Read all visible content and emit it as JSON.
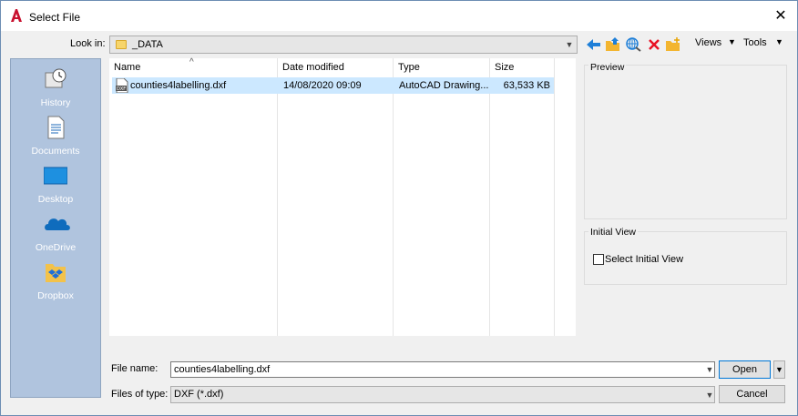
{
  "window": {
    "title": "Select File",
    "close_glyph": "✕"
  },
  "lookin": {
    "label": "Look in:",
    "value": "_DATA"
  },
  "toolbar": {
    "views_label": "Views",
    "tools_label": "Tools"
  },
  "places": [
    {
      "label": "History",
      "icon": "history-icon"
    },
    {
      "label": "Documents",
      "icon": "documents-icon"
    },
    {
      "label": "Desktop",
      "icon": "desktop-icon"
    },
    {
      "label": "OneDrive",
      "icon": "onedrive-icon"
    },
    {
      "label": "Dropbox",
      "icon": "dropbox-icon"
    }
  ],
  "filelist": {
    "columns": [
      "Name",
      "Date modified",
      "Type",
      "Size"
    ],
    "rows": [
      {
        "name": "counties4labelling.dxf",
        "date": "14/08/2020 09:09",
        "type": "AutoCAD Drawing...",
        "size": "63,533 KB"
      }
    ]
  },
  "preview": {
    "title": "Preview"
  },
  "initial_view": {
    "title": "Initial View",
    "checkbox_label": "Select Initial View",
    "checked": false
  },
  "file_name": {
    "label": "File name:",
    "value": "counties4labelling.dxf"
  },
  "file_type": {
    "label": "Files of type:",
    "value": "DXF (*.dxf)"
  },
  "buttons": {
    "open": "Open",
    "cancel": "Cancel"
  },
  "colors": {
    "selection": "#cce8ff",
    "places_bg": "#b0c4de",
    "accent": "#0078d7",
    "delete": "#e81123"
  }
}
